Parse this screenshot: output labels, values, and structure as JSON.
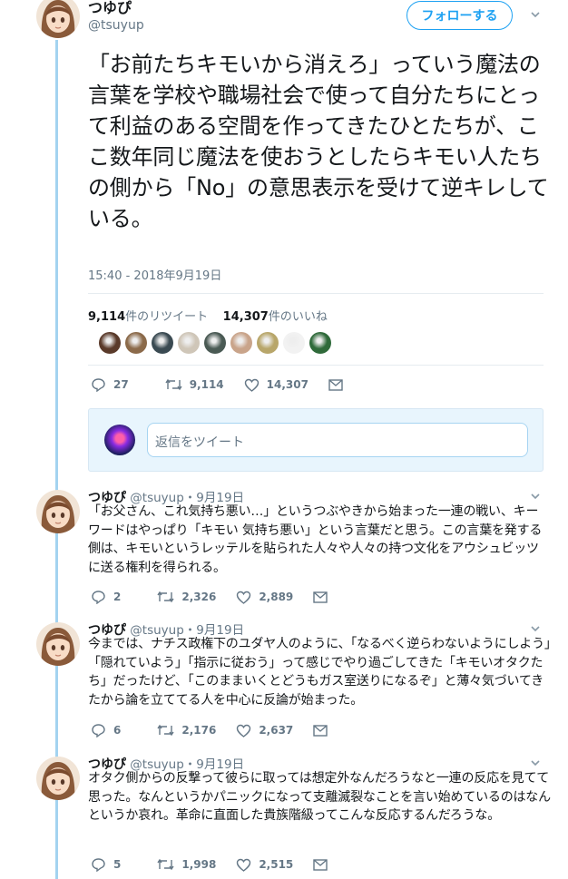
{
  "main_tweet": {
    "display_name": "つゆぴ",
    "handle": "@tsuyup",
    "follow_label": "フォローする",
    "text": "「お前たちキモいから消えろ」っていう魔法の言葉を学校や職場社会で使って自分たちにとって利益のある空間を作ってきたひとたちが、ここ数年同じ魔法を使おうとしたらキモい人たちの側から「No」の意思表示を受けて逆キレしている。",
    "timestamp": "15:40 - 2018年9月19日",
    "retweet_count_label": "9,114",
    "retweet_suffix": "件のリツイート",
    "like_count_label": "14,307",
    "like_suffix": "件のいいね",
    "actions": {
      "reply": "27",
      "retweet": "9,114",
      "like": "14,307"
    },
    "liker_colors": [
      "#5a3a2a",
      "#8b6a4a",
      "#3a4a52",
      "#cfc6b8",
      "#4a5a54",
      "#c9a48a",
      "#b8a66a",
      "#f2f2f2",
      "#2f6a3a"
    ]
  },
  "reply_box": {
    "placeholder": "返信をツイート"
  },
  "replies": [
    {
      "display_name": "つゆぴ",
      "handle": "@tsuyup",
      "date": "9月19日",
      "text": "「お父さん、これ気持ち悪い…」というつぶやきから始まった一連の戦い、キーワードはやっぱり「キモい 気持ち悪い」という言葉だと思う。この言葉を発する側は、キモいというレッテルを貼られた人々や人々の持つ文化をアウシュビッツに送る権利を得られる。",
      "actions": {
        "reply": "2",
        "retweet": "2,326",
        "like": "2,889"
      }
    },
    {
      "display_name": "つゆぴ",
      "handle": "@tsuyup",
      "date": "9月19日",
      "text": "今までは、ナチス政権下のユダヤ人のように、「なるべく逆らわないようにしよう」「隠れていよう」「指示に従おう」って感じでやり過ごしてきた「キモいオタクたち」だったけど、「このままいくとどうもガス室送りになるぞ」と薄々気づいてきたから論を立ててる人を中心に反論が始まった。",
      "actions": {
        "reply": "6",
        "retweet": "2,176",
        "like": "2,637"
      }
    },
    {
      "display_name": "つゆぴ",
      "handle": "@tsuyup",
      "date": "9月19日",
      "text": "オタク側からの反撃って彼らに取っては想定外なんだろうなと一連の反応を見てて思った。なんというかパニックになって支離滅裂なことを言い始めているのはなんというか哀れ。革命に直面した貴族階級ってこんな反応するんだろうな。",
      "actions": {
        "reply": "5",
        "retweet": "1,998",
        "like": "2,515"
      }
    }
  ],
  "separator": "・",
  "colors": {
    "accent": "#1da1f2",
    "muted": "#657786",
    "thread_line": "#a3d3f0"
  }
}
